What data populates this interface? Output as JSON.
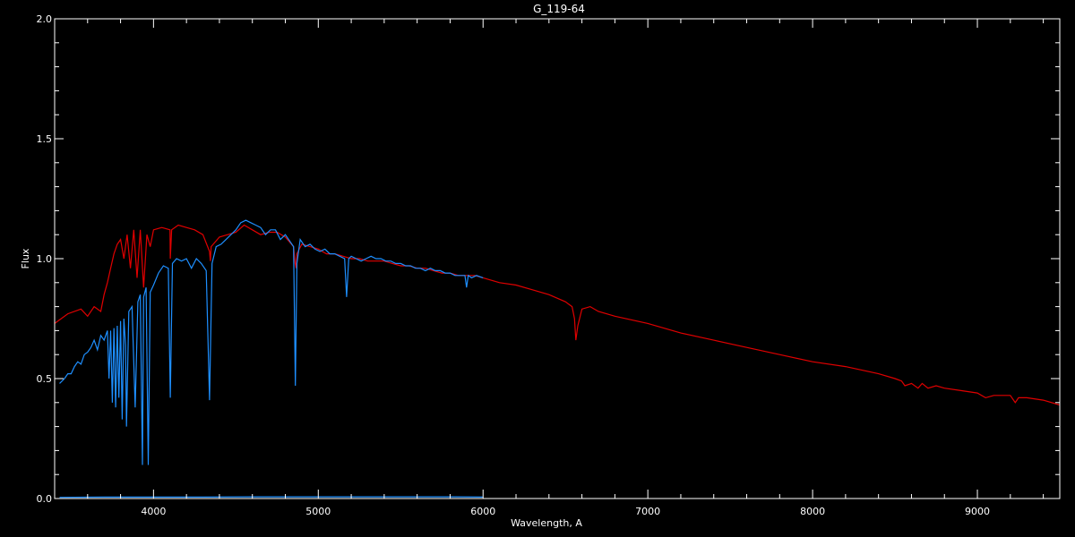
{
  "chart_data": {
    "type": "line",
    "title": "G_119-64",
    "xlabel": "Wavelength, A",
    "ylabel": "Flux",
    "xlim": [
      3400,
      9500
    ],
    "ylim": [
      0.0,
      2.0
    ],
    "x_ticks": [
      4000,
      5000,
      6000,
      7000,
      8000,
      9000
    ],
    "x_tick_labels": [
      "4000",
      "5000",
      "6000",
      "7000",
      "8000",
      "9000"
    ],
    "y_ticks": [
      0.0,
      0.5,
      1.0,
      1.5,
      2.0
    ],
    "y_tick_labels": [
      "0.0",
      "0.5",
      "1.0",
      "1.5",
      "2.0"
    ],
    "grid": false,
    "background": "#000000",
    "axis_color": "#ffffff",
    "series": [
      {
        "color": "#e00000",
        "x": [
          3400,
          3480,
          3560,
          3600,
          3640,
          3680,
          3700,
          3720,
          3740,
          3760,
          3780,
          3800,
          3820,
          3840,
          3860,
          3880,
          3900,
          3920,
          3940,
          3960,
          3980,
          4000,
          4050,
          4100,
          4102,
          4110,
          4150,
          4200,
          4250,
          4300,
          4340,
          4345,
          4350,
          4400,
          4450,
          4500,
          4550,
          4600,
          4650,
          4700,
          4750,
          4800,
          4850,
          4860,
          4865,
          4870,
          4900,
          4950,
          5000,
          5050,
          5100,
          5150,
          5200,
          5250,
          5300,
          5350,
          5400,
          5450,
          5500,
          5550,
          5600,
          5650,
          5700,
          5750,
          5800,
          5850,
          5900,
          5950,
          6000,
          6100,
          6200,
          6300,
          6400,
          6500,
          6540,
          6555,
          6563,
          6575,
          6600,
          6650,
          6700,
          6800,
          7000,
          7200,
          7400,
          7600,
          7800,
          8000,
          8200,
          8400,
          8500,
          8540,
          8560,
          8600,
          8640,
          8665,
          8700,
          8750,
          8800,
          8900,
          9000,
          9050,
          9100,
          9200,
          9230,
          9250,
          9300,
          9400,
          9500
        ],
        "values": [
          0.73,
          0.77,
          0.79,
          0.76,
          0.8,
          0.78,
          0.85,
          0.9,
          0.96,
          1.02,
          1.06,
          1.08,
          1.0,
          1.1,
          0.96,
          1.12,
          0.92,
          1.12,
          0.88,
          1.1,
          1.05,
          1.12,
          1.13,
          1.12,
          1.0,
          1.12,
          1.14,
          1.13,
          1.12,
          1.1,
          1.03,
          0.99,
          1.05,
          1.09,
          1.1,
          1.11,
          1.14,
          1.12,
          1.1,
          1.11,
          1.11,
          1.09,
          1.05,
          0.98,
          0.96,
          1.02,
          1.06,
          1.05,
          1.04,
          1.02,
          1.02,
          1.01,
          1.0,
          1.0,
          0.99,
          0.99,
          0.99,
          0.98,
          0.97,
          0.97,
          0.96,
          0.96,
          0.95,
          0.94,
          0.94,
          0.93,
          0.93,
          0.93,
          0.92,
          0.9,
          0.89,
          0.87,
          0.85,
          0.82,
          0.8,
          0.75,
          0.66,
          0.72,
          0.79,
          0.8,
          0.78,
          0.76,
          0.73,
          0.69,
          0.66,
          0.63,
          0.6,
          0.57,
          0.55,
          0.52,
          0.5,
          0.49,
          0.47,
          0.48,
          0.46,
          0.48,
          0.46,
          0.47,
          0.46,
          0.45,
          0.44,
          0.42,
          0.43,
          0.43,
          0.4,
          0.42,
          0.42,
          0.41,
          0.39
        ]
      },
      {
        "color": "#1e8fff",
        "x": [
          3430,
          3460,
          3480,
          3500,
          3520,
          3540,
          3560,
          3580,
          3600,
          3620,
          3640,
          3660,
          3680,
          3700,
          3720,
          3730,
          3740,
          3750,
          3760,
          3770,
          3780,
          3790,
          3800,
          3810,
          3820,
          3830,
          3836,
          3850,
          3870,
          3889,
          3905,
          3920,
          3933,
          3940,
          3955,
          3968,
          3980,
          4000,
          4030,
          4060,
          4090,
          4102,
          4115,
          4140,
          4170,
          4200,
          4230,
          4260,
          4290,
          4320,
          4340,
          4355,
          4380,
          4410,
          4440,
          4470,
          4500,
          4530,
          4560,
          4590,
          4620,
          4650,
          4680,
          4710,
          4740,
          4770,
          4800,
          4830,
          4850,
          4861,
          4870,
          4890,
          4920,
          4950,
          4980,
          5010,
          5040,
          5070,
          5100,
          5130,
          5160,
          5172,
          5185,
          5200,
          5230,
          5260,
          5290,
          5320,
          5350,
          5380,
          5410,
          5440,
          5470,
          5500,
          5530,
          5560,
          5590,
          5620,
          5650,
          5680,
          5710,
          5740,
          5770,
          5800,
          5830,
          5860,
          5890,
          5900,
          5910,
          5930,
          5960,
          6000
        ],
        "values": [
          0.48,
          0.5,
          0.52,
          0.52,
          0.55,
          0.57,
          0.56,
          0.6,
          0.61,
          0.63,
          0.66,
          0.62,
          0.68,
          0.66,
          0.7,
          0.5,
          0.7,
          0.4,
          0.71,
          0.38,
          0.72,
          0.42,
          0.74,
          0.33,
          0.75,
          0.64,
          0.3,
          0.78,
          0.8,
          0.38,
          0.82,
          0.85,
          0.14,
          0.84,
          0.88,
          0.14,
          0.86,
          0.89,
          0.94,
          0.97,
          0.96,
          0.42,
          0.98,
          1.0,
          0.99,
          1.0,
          0.96,
          1.0,
          0.98,
          0.95,
          0.41,
          0.98,
          1.05,
          1.06,
          1.08,
          1.1,
          1.12,
          1.15,
          1.16,
          1.15,
          1.14,
          1.13,
          1.1,
          1.12,
          1.12,
          1.08,
          1.1,
          1.07,
          1.05,
          0.47,
          0.98,
          1.08,
          1.05,
          1.06,
          1.04,
          1.03,
          1.04,
          1.02,
          1.02,
          1.01,
          1.0,
          0.84,
          1.0,
          1.01,
          1.0,
          0.99,
          1.0,
          1.01,
          1.0,
          1.0,
          0.99,
          0.99,
          0.98,
          0.98,
          0.97,
          0.97,
          0.96,
          0.96,
          0.95,
          0.96,
          0.95,
          0.95,
          0.94,
          0.94,
          0.93,
          0.93,
          0.93,
          0.88,
          0.93,
          0.92,
          0.93,
          0.92
        ]
      },
      {
        "color": "#1e8fff",
        "x": [
          3430,
          3700,
          4000,
          4300,
          4600,
          4900,
          5200,
          5500,
          5800,
          6000
        ],
        "values": [
          0.005,
          0.006,
          0.006,
          0.006,
          0.007,
          0.007,
          0.007,
          0.007,
          0.007,
          0.006
        ]
      }
    ]
  }
}
